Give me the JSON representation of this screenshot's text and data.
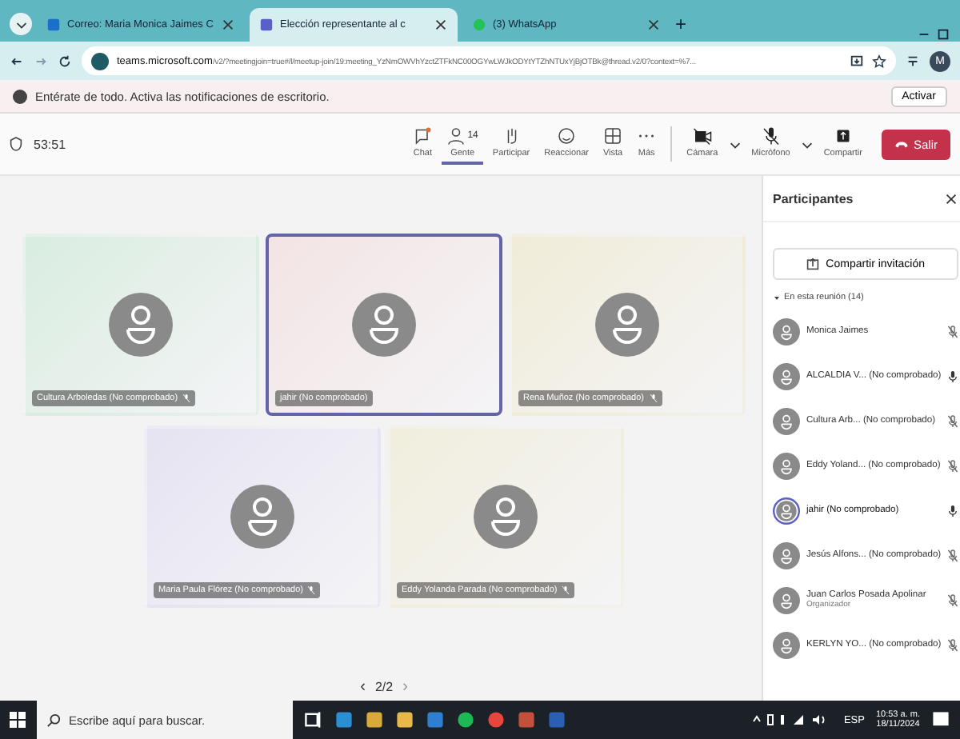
{
  "browser": {
    "tabs": [
      {
        "title": "Correo: Maria Monica Jaimes C",
        "selected": false
      },
      {
        "title": "Elección representante al c",
        "selected": true
      },
      {
        "title": "(3) WhatsApp",
        "selected": false
      }
    ],
    "new_tab": "+",
    "url_host": "teams.microsoft.com",
    "url_rest": "/v2/?meetingjoin=true#/l/meetup-join/19:meeting_YzNmOWVhYzctZTFkNC00OGYwLWJkODYtYTZhNTUxYjBjOTBk@thread.v2/0?context=%7...",
    "profile": "M"
  },
  "notification": {
    "text": "Entérate de todo. Activa las notificaciones de escritorio.",
    "button": "Activar"
  },
  "meeting": {
    "timer": "53:51",
    "people_count": "14",
    "controls": [
      {
        "kind": "chat",
        "label": "Chat",
        "selected": false
      },
      {
        "kind": "people",
        "label": "Gente",
        "selected": true
      },
      {
        "kind": "hand",
        "label": "Participar",
        "selected": false
      },
      {
        "kind": "react",
        "label": "Reaccionar",
        "selected": false
      },
      {
        "kind": "view",
        "label": "Vista",
        "selected": false
      },
      {
        "kind": "more",
        "label": "Más",
        "selected": false
      },
      {
        "kind": "camera",
        "label": "Cámara",
        "selected": false
      },
      {
        "kind": "mic",
        "label": "Micrófono",
        "selected": false
      },
      {
        "kind": "share",
        "label": "Compartir",
        "selected": false
      }
    ],
    "leave": "Salir"
  },
  "tiles": [
    {
      "name": "Cultura Arboledas (No comprobado)",
      "muted": true,
      "selected": false
    },
    {
      "name": "jahir (No comprobado)",
      "muted": false,
      "selected": true
    },
    {
      "name": "Rena Muñoz (No comprobado)",
      "muted": true,
      "selected": false
    },
    {
      "name": "Maria Paula Flórez (No comprobado)",
      "muted": true,
      "selected": false
    },
    {
      "name": "Eddy Yolanda Parada (No comprobado)",
      "muted": true,
      "selected": false
    }
  ],
  "pager": {
    "prev": "‹",
    "page": "2/2",
    "next": "›"
  },
  "panel": {
    "title": "Participantes",
    "share_button": "Compartir invitación",
    "section": "En esta reunión (14)",
    "participants": [
      {
        "name": "Monica Jaimes",
        "muted": true,
        "speaking": false
      },
      {
        "name": "ALCALDIA V... (No comprobado)",
        "muted": false,
        "speaking": false
      },
      {
        "name": "Cultura Arb... (No comprobado)",
        "muted": true,
        "speaking": false
      },
      {
        "name": "Eddy Yoland... (No comprobado)",
        "muted": true,
        "speaking": false
      },
      {
        "name": "jahir (No comprobado)",
        "muted": false,
        "speaking": true
      },
      {
        "name": "Jesús Alfons... (No comprobado)",
        "muted": true,
        "speaking": false
      },
      {
        "name": "Juan Carlos Posada Apolinar",
        "role": "Organizador",
        "muted": true,
        "speaking": false
      },
      {
        "name": "KERLYN YO... (No comprobado)",
        "muted": true,
        "speaking": false
      }
    ]
  },
  "taskbar": {
    "search_placeholder": "Escribe aquí para buscar.",
    "lang": "ESP",
    "time": "10:53 a. m.",
    "date": "18/11/2024"
  }
}
